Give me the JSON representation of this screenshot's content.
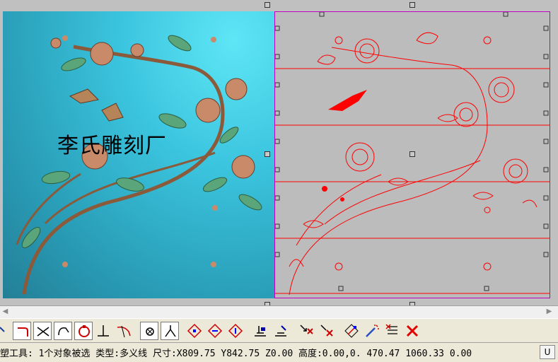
{
  "viewport": {
    "relief_title": "李氏雕刻厂",
    "colors": {
      "relief_bg": "#3bc4de",
      "vector_line": "#ff0000",
      "selection_border": "#c000c0",
      "panel_bg": "#bcbcbc"
    }
  },
  "toolbar": {
    "tools": [
      {
        "name": "node-edit-icon"
      },
      {
        "name": "fillet-icon"
      },
      {
        "name": "cut-cross-icon"
      },
      {
        "name": "arc-icon"
      },
      {
        "name": "circle-node-icon"
      },
      {
        "name": "perpendicular-icon"
      },
      {
        "name": "trim-curve-icon"
      },
      {
        "name": "point-icon"
      },
      {
        "name": "angle-icon"
      },
      {
        "name": "diamond-node-a-icon"
      },
      {
        "name": "diamond-node-b-icon"
      },
      {
        "name": "diamond-node-c-icon"
      },
      {
        "name": "align-bottom-icon"
      },
      {
        "name": "align-bottom-right-icon"
      },
      {
        "name": "select-delete-icon"
      },
      {
        "name": "select-cross-icon"
      },
      {
        "name": "transform-nodes-icon"
      },
      {
        "name": "wand-icon"
      },
      {
        "name": "list-edit-icon"
      },
      {
        "name": "delete-icon"
      }
    ]
  },
  "status": {
    "text": "塑工具: 1个对象被选 类型:多义线 尺寸:X809.75 Y842.75 Z0.00 高度:0.00,0. 470.47 1060.33 0.00",
    "unit": "U"
  }
}
